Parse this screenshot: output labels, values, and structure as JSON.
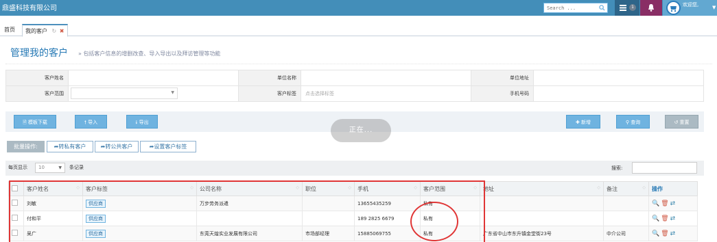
{
  "navbar": {
    "brand": "鼎盛科技有限公司",
    "search_placeholder": "Search ...",
    "badge_count": "1",
    "welcome": "欢迎您,",
    "icons": {
      "search": "search-icon",
      "tasks": "tasks-icon",
      "bell": "bell-icon",
      "user": "user-avatar-icon"
    },
    "colors": {
      "bar": "#438eb9",
      "tasks": "#2e6589",
      "notif": "#892e65",
      "user": "#62a8d1"
    }
  },
  "tabs": {
    "home": "首页",
    "active": "我的客户"
  },
  "page": {
    "title": "管理我的客户",
    "description": "» 包括客户信息的增删改查、导入导出以及拜访管理等功能"
  },
  "form": {
    "name_label": "客户姓名",
    "company_label": "单位名称",
    "address_label": "单位地址",
    "range_label": "客户范围",
    "tag_label": "客户标签",
    "tag_placeholder": "点击选择标签",
    "phone_label": "手机号码"
  },
  "actions": {
    "template": "模板下载",
    "import": "导入",
    "export": "导出",
    "add": "新增",
    "query": "查询",
    "reset": "重置",
    "loading": "正在..."
  },
  "batch": {
    "label": "批量操作:",
    "to_private": "转私有客户",
    "to_public": "转公共客户",
    "set_tag": "设置客户标签"
  },
  "table_toolbar": {
    "per_page_label": "每页显示",
    "per_page_value": "10",
    "records_label": "条记录",
    "search_label": "搜索:"
  },
  "table": {
    "headers": [
      "客户姓名",
      "客户标签",
      "公司名称",
      "职位",
      "手机",
      "客户范围",
      "地址",
      "备注",
      "操作"
    ],
    "rows": [
      {
        "name": "刘敏",
        "tag": "供应商",
        "company": "万步劳务派遣",
        "position": "",
        "phone": "13655435259",
        "range": "私有",
        "address": "",
        "note": ""
      },
      {
        "name": "付和平",
        "tag": "供应商",
        "company": "",
        "position": "",
        "phone": "189 2825 6679",
        "range": "私有",
        "address": "",
        "note": ""
      },
      {
        "name": "吴广",
        "tag": "供应商",
        "company": "东莞天煌实业发展有限公司",
        "position": "市场部经理",
        "phone": "15885069755",
        "range": "私有",
        "address": "广东省中山市东升镇金堂街23号",
        "note": "中介公司"
      }
    ]
  }
}
